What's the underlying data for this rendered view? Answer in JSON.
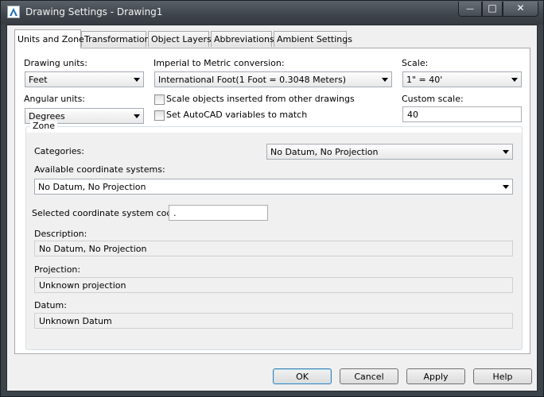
{
  "window": {
    "title": "Drawing Settings - Drawing1",
    "controls": {
      "minimize": "—",
      "maximize": "□",
      "close": "✕"
    }
  },
  "tabs": [
    "Units and Zone",
    "Transformation",
    "Object Layers",
    "Abbreviations",
    "Ambient Settings"
  ],
  "units": {
    "drawing_units_label": "Drawing units:",
    "drawing_units_value": "Feet",
    "conversion_label": "Imperial to Metric conversion:",
    "conversion_value": "International Foot(1 Foot = 0.3048 Meters)",
    "scale_label": "Scale:",
    "scale_value": "1\" = 40'",
    "angular_units_label": "Angular units:",
    "angular_units_value": "Degrees",
    "scale_objects_label": "Scale objects inserted from other drawings",
    "set_variables_label": "Set AutoCAD variables to match",
    "custom_scale_label": "Custom scale:",
    "custom_scale_value": "40"
  },
  "zone": {
    "legend": "Zone",
    "categories_label": "Categories:",
    "categories_value": "No Datum, No Projection",
    "available_label": "Available coordinate systems:",
    "available_value": "No Datum, No Projection",
    "selected_code_label": "Selected coordinate system code:",
    "selected_code_value": ".",
    "description_label": "Description:",
    "description_value": "No Datum, No Projection",
    "projection_label": "Projection:",
    "projection_value": "Unknown projection",
    "datum_label": "Datum:",
    "datum_value": "Unknown Datum"
  },
  "buttons": {
    "ok": "OK",
    "cancel": "Cancel",
    "apply": "Apply",
    "help": "Help"
  }
}
